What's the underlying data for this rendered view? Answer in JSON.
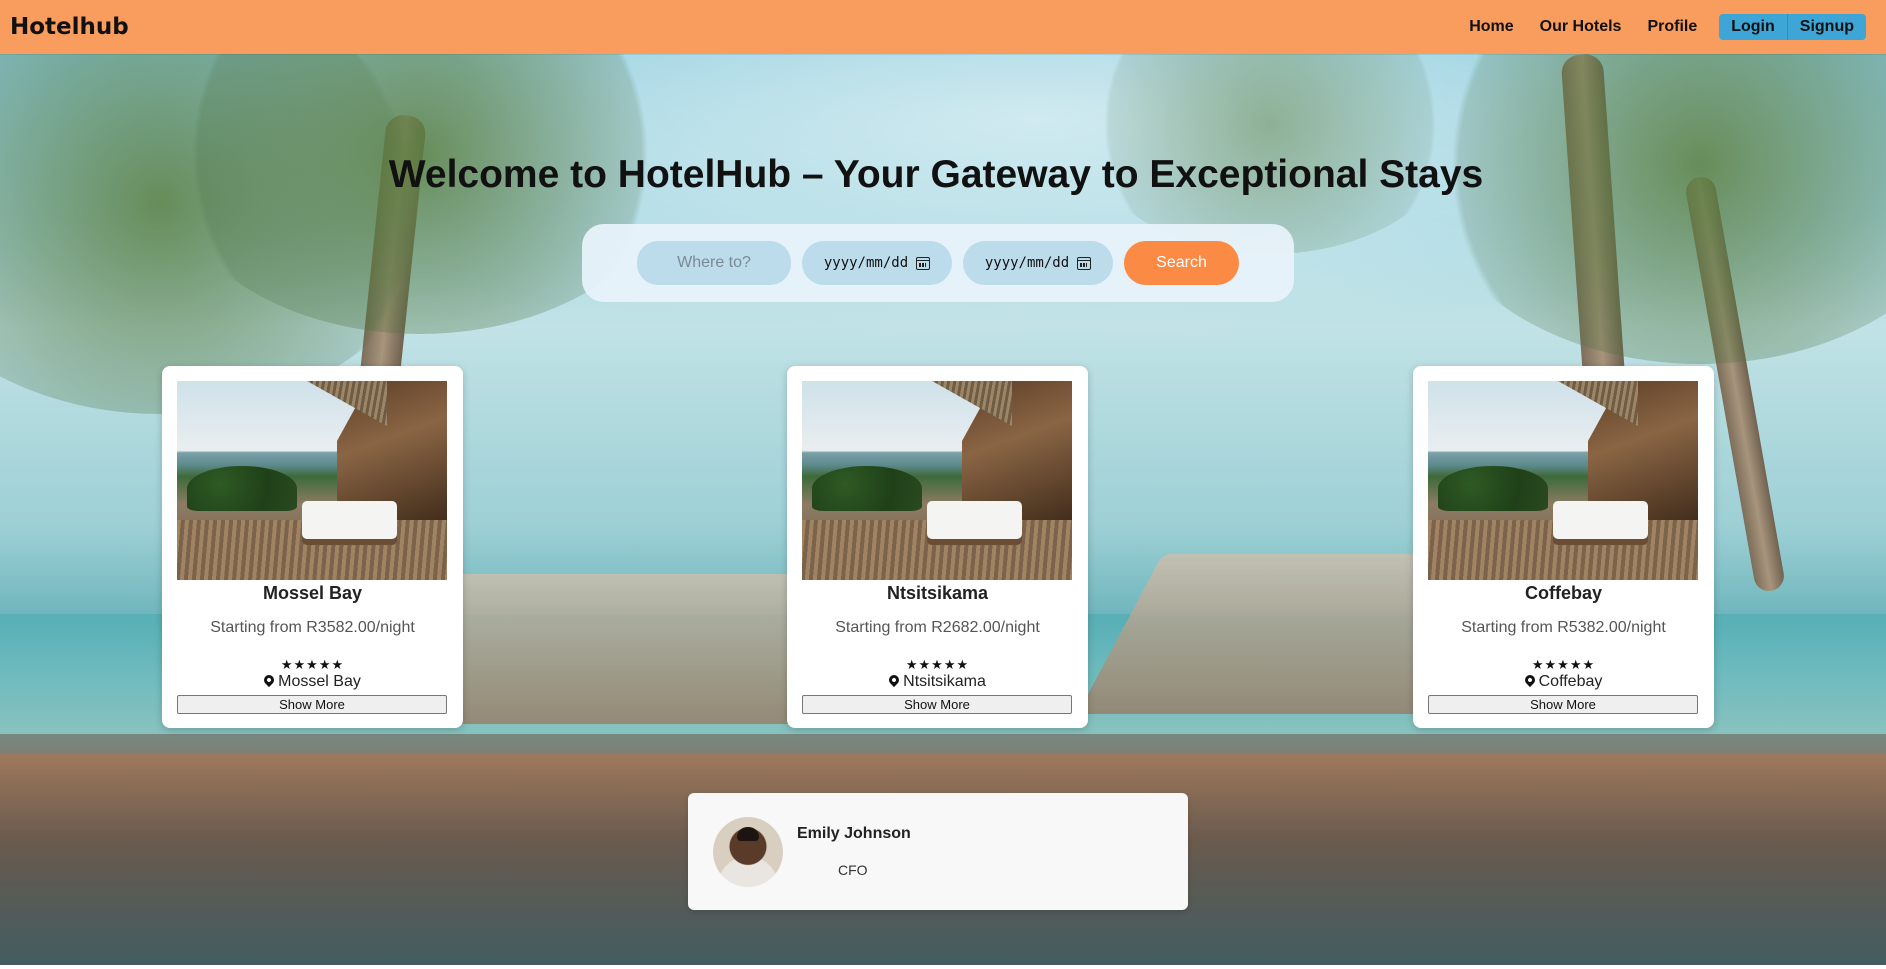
{
  "nav": {
    "brand": "Hotelhub",
    "links": [
      "Home",
      "Our Hotels",
      "Profile"
    ],
    "login": "Login",
    "signup": "Signup"
  },
  "hero": {
    "title": "Welcome to HotelHub – Your Gateway to Exceptional Stays"
  },
  "search": {
    "where_placeholder": "Where to?",
    "checkin_placeholder": "yyyy/mm/dd",
    "checkout_placeholder": "yyyy/mm/dd",
    "button": "Search"
  },
  "hotels": [
    {
      "name": "Mossel Bay",
      "price": "Starting from R3582.00/night",
      "stars": "★★★★★",
      "location": "Mossel Bay",
      "button": "Show More"
    },
    {
      "name": "Ntsitsikama",
      "price": "Starting from R2682.00/night",
      "stars": "★★★★★",
      "location": "Ntsitsikama",
      "button": "Show More"
    },
    {
      "name": "Coffebay",
      "price": "Starting from R5382.00/night",
      "stars": "★★★★★",
      "location": "Coffebay",
      "button": "Show More"
    }
  ],
  "team": {
    "name": "Emily Johnson",
    "role": "CFO"
  },
  "colors": {
    "navbar": "#f99d5e",
    "auth": "#3ea6d6",
    "search_button": "#fb8a45",
    "input_bg": "#bcdcec"
  }
}
